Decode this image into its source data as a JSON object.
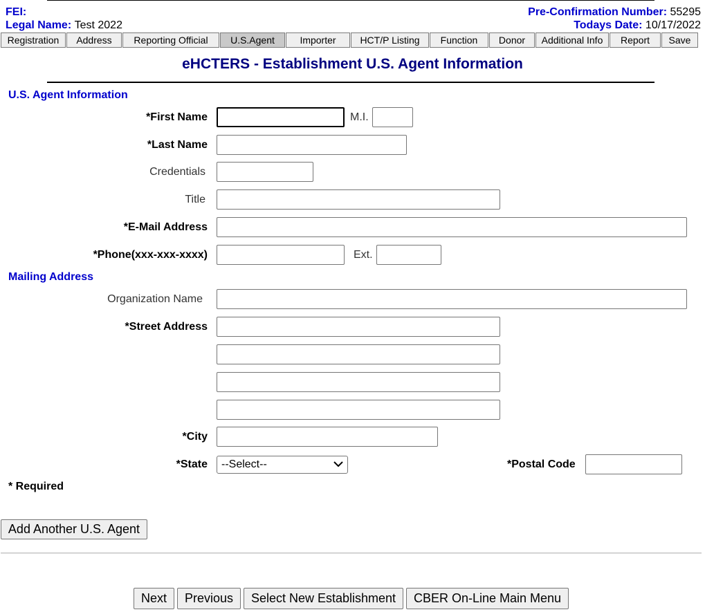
{
  "header": {
    "fei_label": "FEI:",
    "fei_value": "",
    "legal_name_label": "Legal Name:",
    "legal_name_value": "Test 2022",
    "preconf_label": "Pre-Confirmation Number:",
    "preconf_value": "55295",
    "date_label": "Todays Date:",
    "date_value": "10/17/2022"
  },
  "tabs": [
    {
      "label": "Registration"
    },
    {
      "label": "Address"
    },
    {
      "label": "Reporting Official"
    },
    {
      "label": "U.S.Agent"
    },
    {
      "label": "Importer"
    },
    {
      "label": "HCT/P Listing"
    },
    {
      "label": "Function"
    },
    {
      "label": "Donor"
    },
    {
      "label": "Additional Info"
    },
    {
      "label": "Report"
    },
    {
      "label": "Save"
    }
  ],
  "page_title": "eHCTERS - Establishment U.S. Agent Information",
  "agent_section": {
    "title": "U.S. Agent Information",
    "first_name_label": "*First Name",
    "mi_label": "M.I.",
    "last_name_label": "*Last Name",
    "credentials_label": "Credentials",
    "title_label": "Title",
    "email_label": "*E-Mail Address",
    "phone_label": "*Phone(xxx-xxx-xxxx)",
    "ext_label": "Ext."
  },
  "mailing_section": {
    "title": "Mailing Address",
    "org_label": "Organization Name",
    "street_label": "*Street Address",
    "city_label": "*City",
    "state_label": "*State",
    "state_value": "--Select--",
    "postal_label": "*Postal Code"
  },
  "required_note": "* Required",
  "buttons": {
    "add_agent": "Add Another U.S. Agent",
    "next": "Next",
    "previous": "Previous",
    "select_new": "Select New Establishment",
    "main_menu": "CBER On-Line Main Menu"
  },
  "icons": {
    "dropdown": "chevron-down-icon"
  }
}
